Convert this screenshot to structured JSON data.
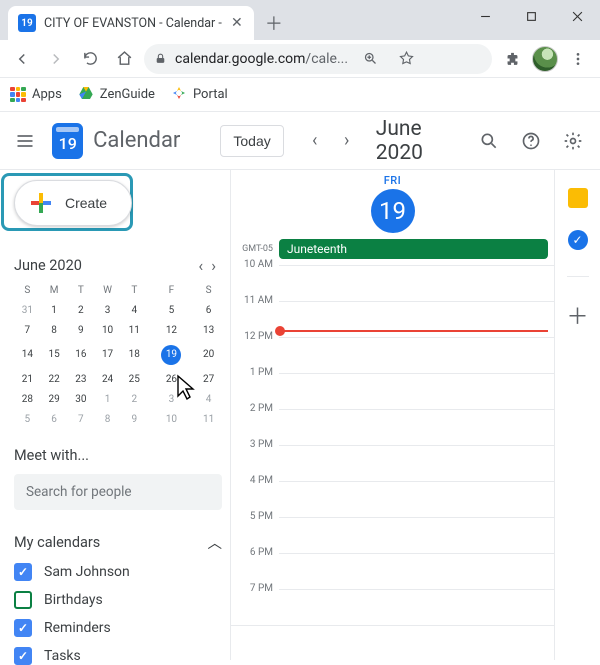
{
  "browser": {
    "tab_title": "CITY OF EVANSTON - Calendar -",
    "favicon_text": "19",
    "url_host": "calendar.google.com",
    "url_path": "/cale..."
  },
  "bookmarks": {
    "apps": "Apps",
    "zenguide": "ZenGuide",
    "portal": "Portal"
  },
  "header": {
    "logo_day": "19",
    "app_name": "Calendar",
    "today": "Today",
    "month_label": "June 2020"
  },
  "create": {
    "label": "Create"
  },
  "minical": {
    "title": "June 2020",
    "dow": [
      "S",
      "M",
      "T",
      "W",
      "T",
      "F",
      "S"
    ],
    "weeks": [
      [
        {
          "d": "31",
          "dim": true
        },
        {
          "d": "1"
        },
        {
          "d": "2"
        },
        {
          "d": "3"
        },
        {
          "d": "4"
        },
        {
          "d": "5"
        },
        {
          "d": "6"
        }
      ],
      [
        {
          "d": "7"
        },
        {
          "d": "8"
        },
        {
          "d": "9"
        },
        {
          "d": "10"
        },
        {
          "d": "11"
        },
        {
          "d": "12"
        },
        {
          "d": "13"
        }
      ],
      [
        {
          "d": "14"
        },
        {
          "d": "15"
        },
        {
          "d": "16"
        },
        {
          "d": "17"
        },
        {
          "d": "18"
        },
        {
          "d": "19",
          "today": true
        },
        {
          "d": "20"
        }
      ],
      [
        {
          "d": "21"
        },
        {
          "d": "22"
        },
        {
          "d": "23"
        },
        {
          "d": "24"
        },
        {
          "d": "25"
        },
        {
          "d": "26"
        },
        {
          "d": "27"
        }
      ],
      [
        {
          "d": "28"
        },
        {
          "d": "29"
        },
        {
          "d": "30"
        },
        {
          "d": "1",
          "dim": true
        },
        {
          "d": "2",
          "dim": true
        },
        {
          "d": "3",
          "dim": true
        },
        {
          "d": "4",
          "dim": true
        }
      ],
      [
        {
          "d": "5",
          "dim": true
        },
        {
          "d": "6",
          "dim": true
        },
        {
          "d": "7",
          "dim": true
        },
        {
          "d": "8",
          "dim": true
        },
        {
          "d": "9",
          "dim": true
        },
        {
          "d": "10",
          "dim": true
        },
        {
          "d": "11",
          "dim": true
        }
      ]
    ]
  },
  "meet": {
    "label": "Meet with...",
    "placeholder": "Search for people"
  },
  "my_calendars": {
    "title": "My calendars",
    "items": [
      {
        "label": "Sam Johnson",
        "color": "#4285f4",
        "checked": true
      },
      {
        "label": "Birthdays",
        "color": "#0b8043",
        "checked": false
      },
      {
        "label": "Reminders",
        "color": "#4285f4",
        "checked": true
      },
      {
        "label": "Tasks",
        "color": "#4285f4",
        "checked": true
      }
    ]
  },
  "day": {
    "abbr": "FRI",
    "num": "19",
    "tz": "GMT-05",
    "allday_event": "Juneteenth",
    "hours": [
      "10 AM",
      "11 AM",
      "12 PM",
      "1 PM",
      "2 PM",
      "3 PM",
      "4 PM",
      "5 PM",
      "6 PM",
      "7 PM"
    ]
  },
  "apps_colors": [
    "#ea4335",
    "#fbbc04",
    "#34a853",
    "#4285f4",
    "#ea4335",
    "#fbbc04",
    "#34a853",
    "#4285f4",
    "#ea4335"
  ]
}
